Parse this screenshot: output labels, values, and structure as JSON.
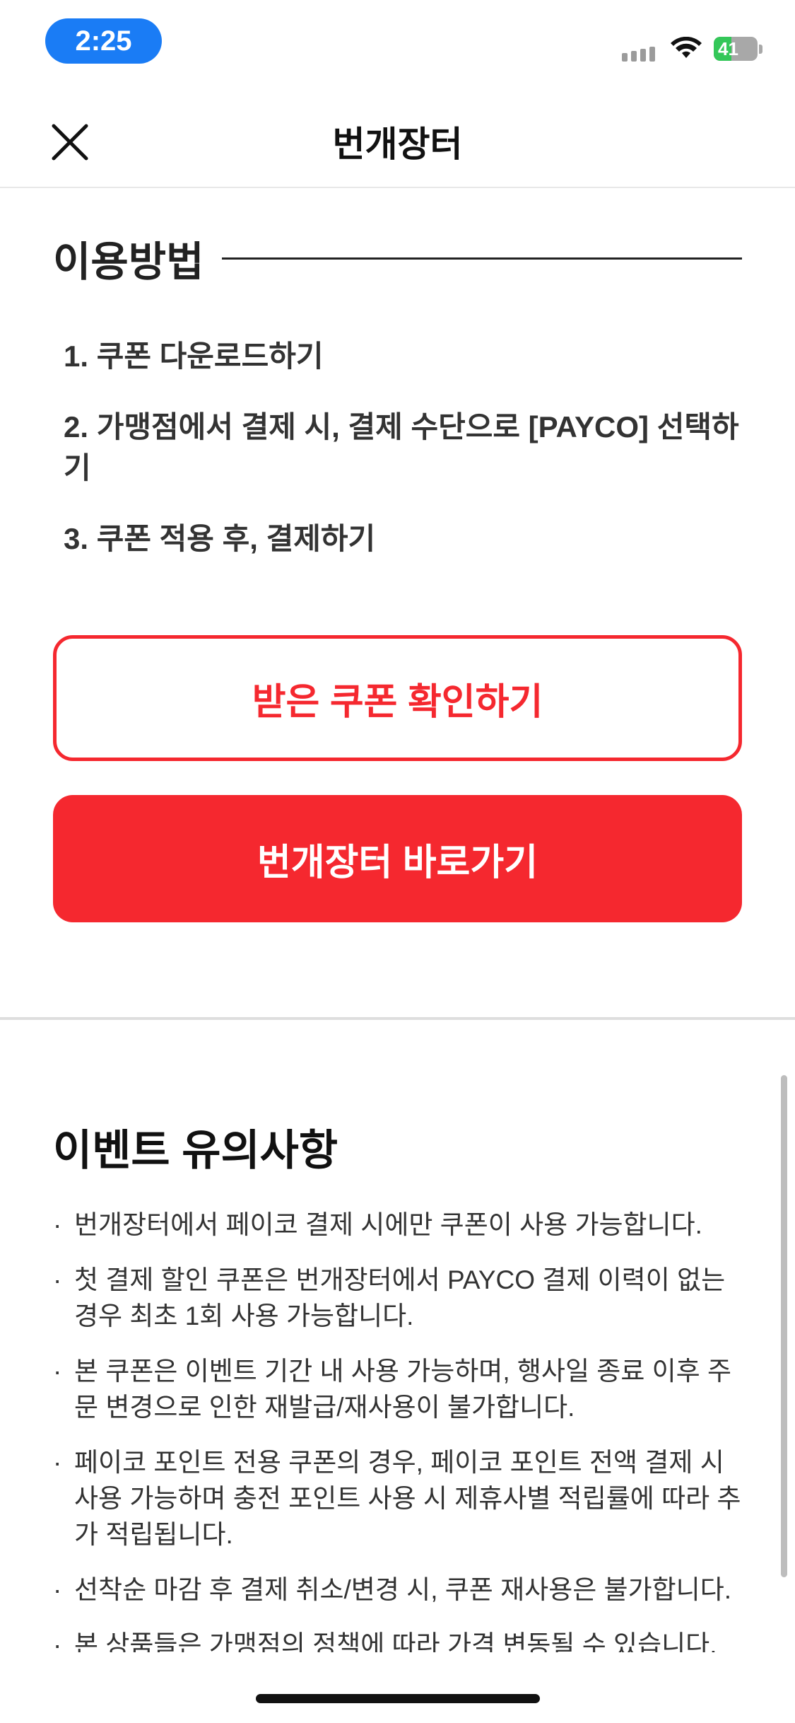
{
  "status_bar": {
    "time": "2:25",
    "battery": "41",
    "battery_level": 0.41
  },
  "header": {
    "title": "번개장터",
    "close_icon": "close-icon"
  },
  "usage": {
    "title": "이용방법",
    "steps": [
      "1. 쿠폰 다운로드하기",
      "2. 가맹점에서 결제 시, 결제 수단으로 [PAYCO] 선택하기",
      "3. 쿠폰 적용 후, 결제하기"
    ]
  },
  "buttons": {
    "check_coupon": "받은 쿠폰 확인하기",
    "go_bunjang": "번개장터 바로가기"
  },
  "notes": {
    "title": "이벤트 유의사항",
    "bullet": "·",
    "items": [
      "번개장터에서 페이코 결제 시에만 쿠폰이 사용 가능합니다.",
      "첫 결제 할인 쿠폰은 번개장터에서 PAYCO 결제 이력이 없는 경우 최초 1회 사용 가능합니다.",
      "본 쿠폰은 이벤트 기간 내 사용 가능하며, 행사일 종료 이후 주문 변경으로 인한 재발급/재사용이 불가합니다.",
      "페이코 포인트 전용 쿠폰의 경우, 페이코 포인트 전액 결제 시 사용 가능하며 충전 포인트 사용 시 제휴사별 적립률에 따라 추가 적립됩니다.",
      "선착순 마감 후 결제 취소/변경 시, 쿠폰 재사용은 불가합니다.",
      "본 상품들은 가맹점의 정책에 따라 가격 변동될 수 있습니다."
    ]
  },
  "colors": {
    "accent": "#f5282f",
    "time_pill": "#1a7cf5",
    "battery_green": "#34c759"
  }
}
